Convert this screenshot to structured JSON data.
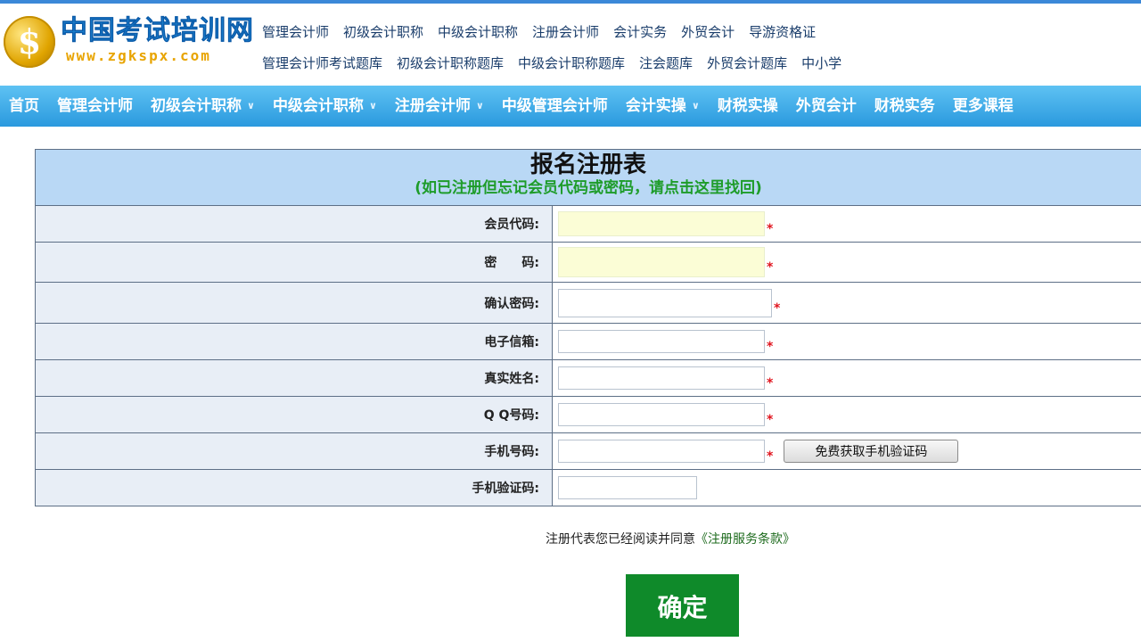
{
  "header": {
    "logo_glyph": "$",
    "logo_title": "中国考试培训网",
    "logo_url": "www.zgkspx.com",
    "top_links_row1": [
      "管理会计师",
      "初级会计职称",
      "中级会计职称",
      "注册会计师",
      "会计实务",
      "外贸会计",
      "导游资格证"
    ],
    "top_links_row2": [
      "管理会计师考试题库",
      "初级会计职称题库",
      "中级会计职称题库",
      "注会题库",
      "外贸会计题库",
      "中小学"
    ]
  },
  "nav": [
    {
      "label": "首页",
      "dropdown": false
    },
    {
      "label": "管理会计师",
      "dropdown": false
    },
    {
      "label": "初级会计职称",
      "dropdown": true
    },
    {
      "label": "中级会计职称",
      "dropdown": true
    },
    {
      "label": "注册会计师",
      "dropdown": true
    },
    {
      "label": "中级管理会计师",
      "dropdown": false
    },
    {
      "label": "会计实操",
      "dropdown": true
    },
    {
      "label": "财税实操",
      "dropdown": false
    },
    {
      "label": "外贸会计",
      "dropdown": false
    },
    {
      "label": "财税实务",
      "dropdown": false
    },
    {
      "label": "更多课程",
      "dropdown": false
    }
  ],
  "form": {
    "title": "报名注册表",
    "subtitle": "(如已注册但忘记会员代码或密码，请点击这里找回)",
    "fields": {
      "member_code": "会员代码:",
      "password": "密　　码:",
      "confirm_password": "确认密码:",
      "email": "电子信箱:",
      "real_name": "真实姓名:",
      "qq": "Q Q号码:",
      "phone": "手机号码:",
      "sms_code": "手机验证码:"
    },
    "required_mark": "*",
    "sms_button": "免费获取手机验证码"
  },
  "agree": {
    "prefix": "注册代表您已经阅读并同意",
    "link": "《注册服务条款》"
  },
  "confirm_label": "确定",
  "colors": {
    "nav": "#2a99de",
    "header_bg": "#b9d8f5",
    "subtitle": "#1e9c2a",
    "confirm": "#0f8a2a",
    "required": "#e0141e"
  }
}
